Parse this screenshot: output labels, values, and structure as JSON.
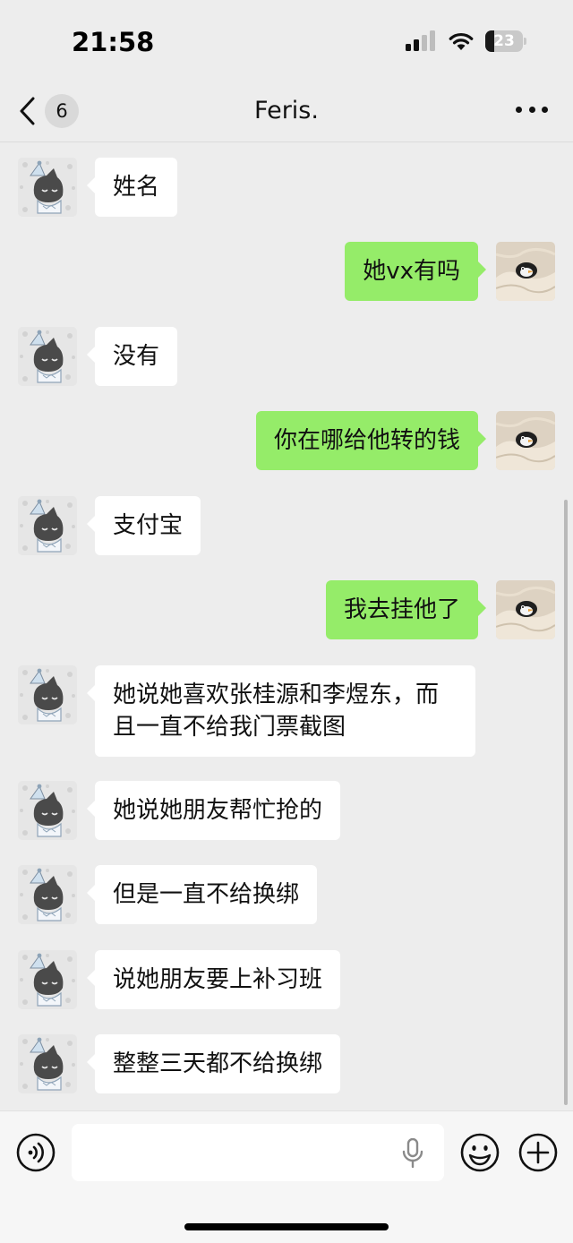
{
  "status_bar": {
    "time": "21:58",
    "battery_level": "23",
    "icons": [
      "signal-icon",
      "wifi-icon",
      "battery-icon"
    ]
  },
  "nav": {
    "unread_count": "6",
    "title": "Feris.",
    "icons": [
      "back-chevron-icon",
      "more-dots-icon"
    ]
  },
  "colors": {
    "background": "#ededed",
    "sent_bubble": "#95ec69",
    "received_bubble": "#ffffff"
  },
  "messages": [
    {
      "side": "received",
      "text": "姓名"
    },
    {
      "side": "sent",
      "text": "她vx有吗"
    },
    {
      "side": "received",
      "text": "没有"
    },
    {
      "side": "sent",
      "text": "你在哪给他转的钱"
    },
    {
      "side": "received",
      "text": "支付宝"
    },
    {
      "side": "sent",
      "text": "我去挂他了"
    },
    {
      "side": "received",
      "text": "她说她喜欢张桂源和李煜东，而且一直不给我门票截图"
    },
    {
      "side": "received",
      "text": "她说她朋友帮忙抢的"
    },
    {
      "side": "received",
      "text": "但是一直不给换绑"
    },
    {
      "side": "received",
      "text": "说她朋友要上补习班"
    },
    {
      "side": "received",
      "text": "整整三天都不给换绑"
    }
  ],
  "avatars": {
    "received": "cartoon-cat-party-hat-avatar",
    "sent": "penguin-under-blanket-avatar"
  },
  "input_bar": {
    "value": "",
    "icons": [
      "voice-icon",
      "microphone-icon",
      "emoji-icon",
      "plus-icon"
    ]
  }
}
